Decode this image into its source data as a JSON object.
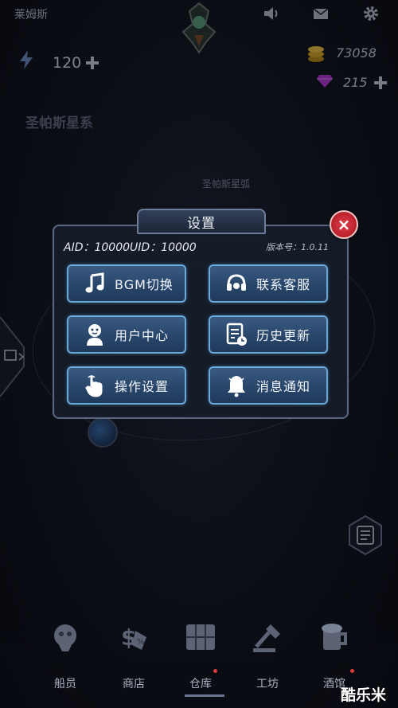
{
  "header": {
    "player_name": "莱姆斯",
    "energy": "120",
    "gold": "73058",
    "gems": "215"
  },
  "map": {
    "star_system": "圣帕斯星系",
    "arc_label": "圣帕斯星弧"
  },
  "dialog": {
    "title": "设置",
    "close": "×",
    "aid_uid": "AID：10000UID：10000",
    "version": "版本号：1.0.11",
    "buttons": [
      {
        "label": "BGM切换",
        "icon": "music-note-icon"
      },
      {
        "label": "联系客服",
        "icon": "headset-icon"
      },
      {
        "label": "用户中心",
        "icon": "user-icon"
      },
      {
        "label": "历史更新",
        "icon": "update-log-icon"
      },
      {
        "label": "操作设置",
        "icon": "tap-hand-icon"
      },
      {
        "label": "消息通知",
        "icon": "bell-icon"
      }
    ]
  },
  "nav": {
    "items": [
      {
        "label": "船员",
        "icon": "crew-icon"
      },
      {
        "label": "商店",
        "icon": "shop-icon"
      },
      {
        "label": "仓库",
        "icon": "warehouse-icon"
      },
      {
        "label": "工坊",
        "icon": "workshop-icon"
      },
      {
        "label": "酒馆",
        "icon": "tavern-icon"
      }
    ]
  },
  "watermark": "酷乐米",
  "colors": {
    "button_border": "#6aa8d6",
    "button_fill": "#29466a",
    "close_red": "#c21f28",
    "gem_purple": "#b13bd6",
    "gold": "#d6a72c"
  }
}
